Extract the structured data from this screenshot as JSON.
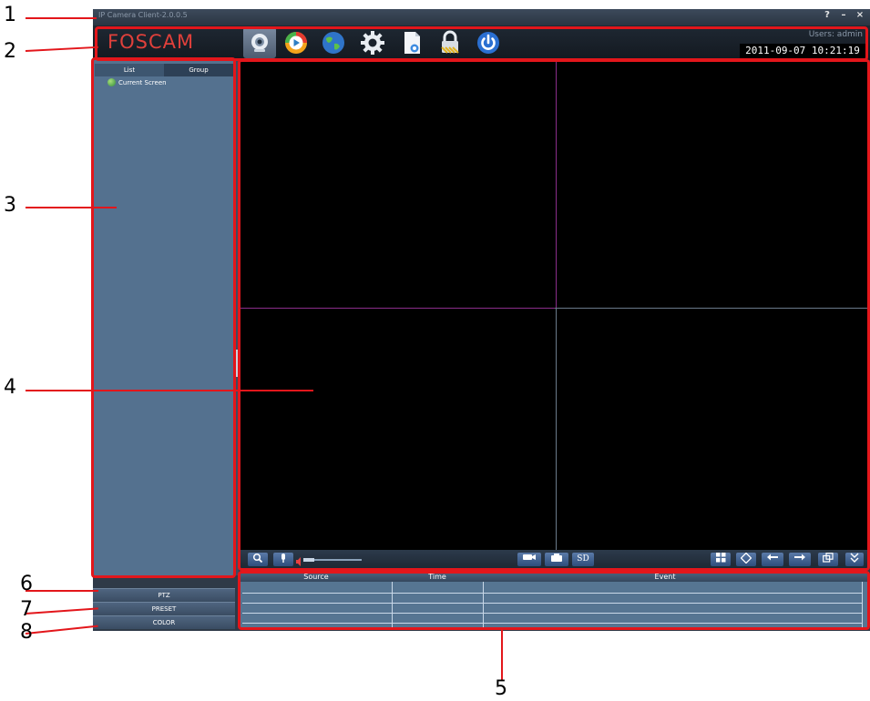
{
  "window": {
    "title": "IP Camera Client-2.0.0.5",
    "help_label": "?",
    "minimize_label": "–",
    "close_label": "×"
  },
  "toolbar": {
    "logo": "FOSCAM",
    "icons": [
      "camera-live-view-icon",
      "playback-icon",
      "globe-icon",
      "gear-icon",
      "log-page-icon",
      "lock-icon",
      "power-icon"
    ],
    "users": "Users: admin",
    "datetime": "2011-09-07 10:21:19"
  },
  "left_panel": {
    "tabs": [
      "List",
      "Group"
    ],
    "tree_item": "Current Screen"
  },
  "bottom_buttons": [
    "PTZ",
    "PRESET",
    "COLOR"
  ],
  "video_bar": {
    "sd_label": "SD"
  },
  "event_table": {
    "columns": [
      "Source",
      "Time",
      "Event"
    ]
  },
  "annotations": [
    "1",
    "2",
    "3",
    "4",
    "5",
    "6",
    "7",
    "8"
  ],
  "colors": {
    "annotation_red": "#e3161b",
    "logo_red": "#e0403b",
    "grid_purple": "#8a2d8a",
    "grid_gray": "#6a7a8a",
    "panel_blue": "#54718f"
  }
}
